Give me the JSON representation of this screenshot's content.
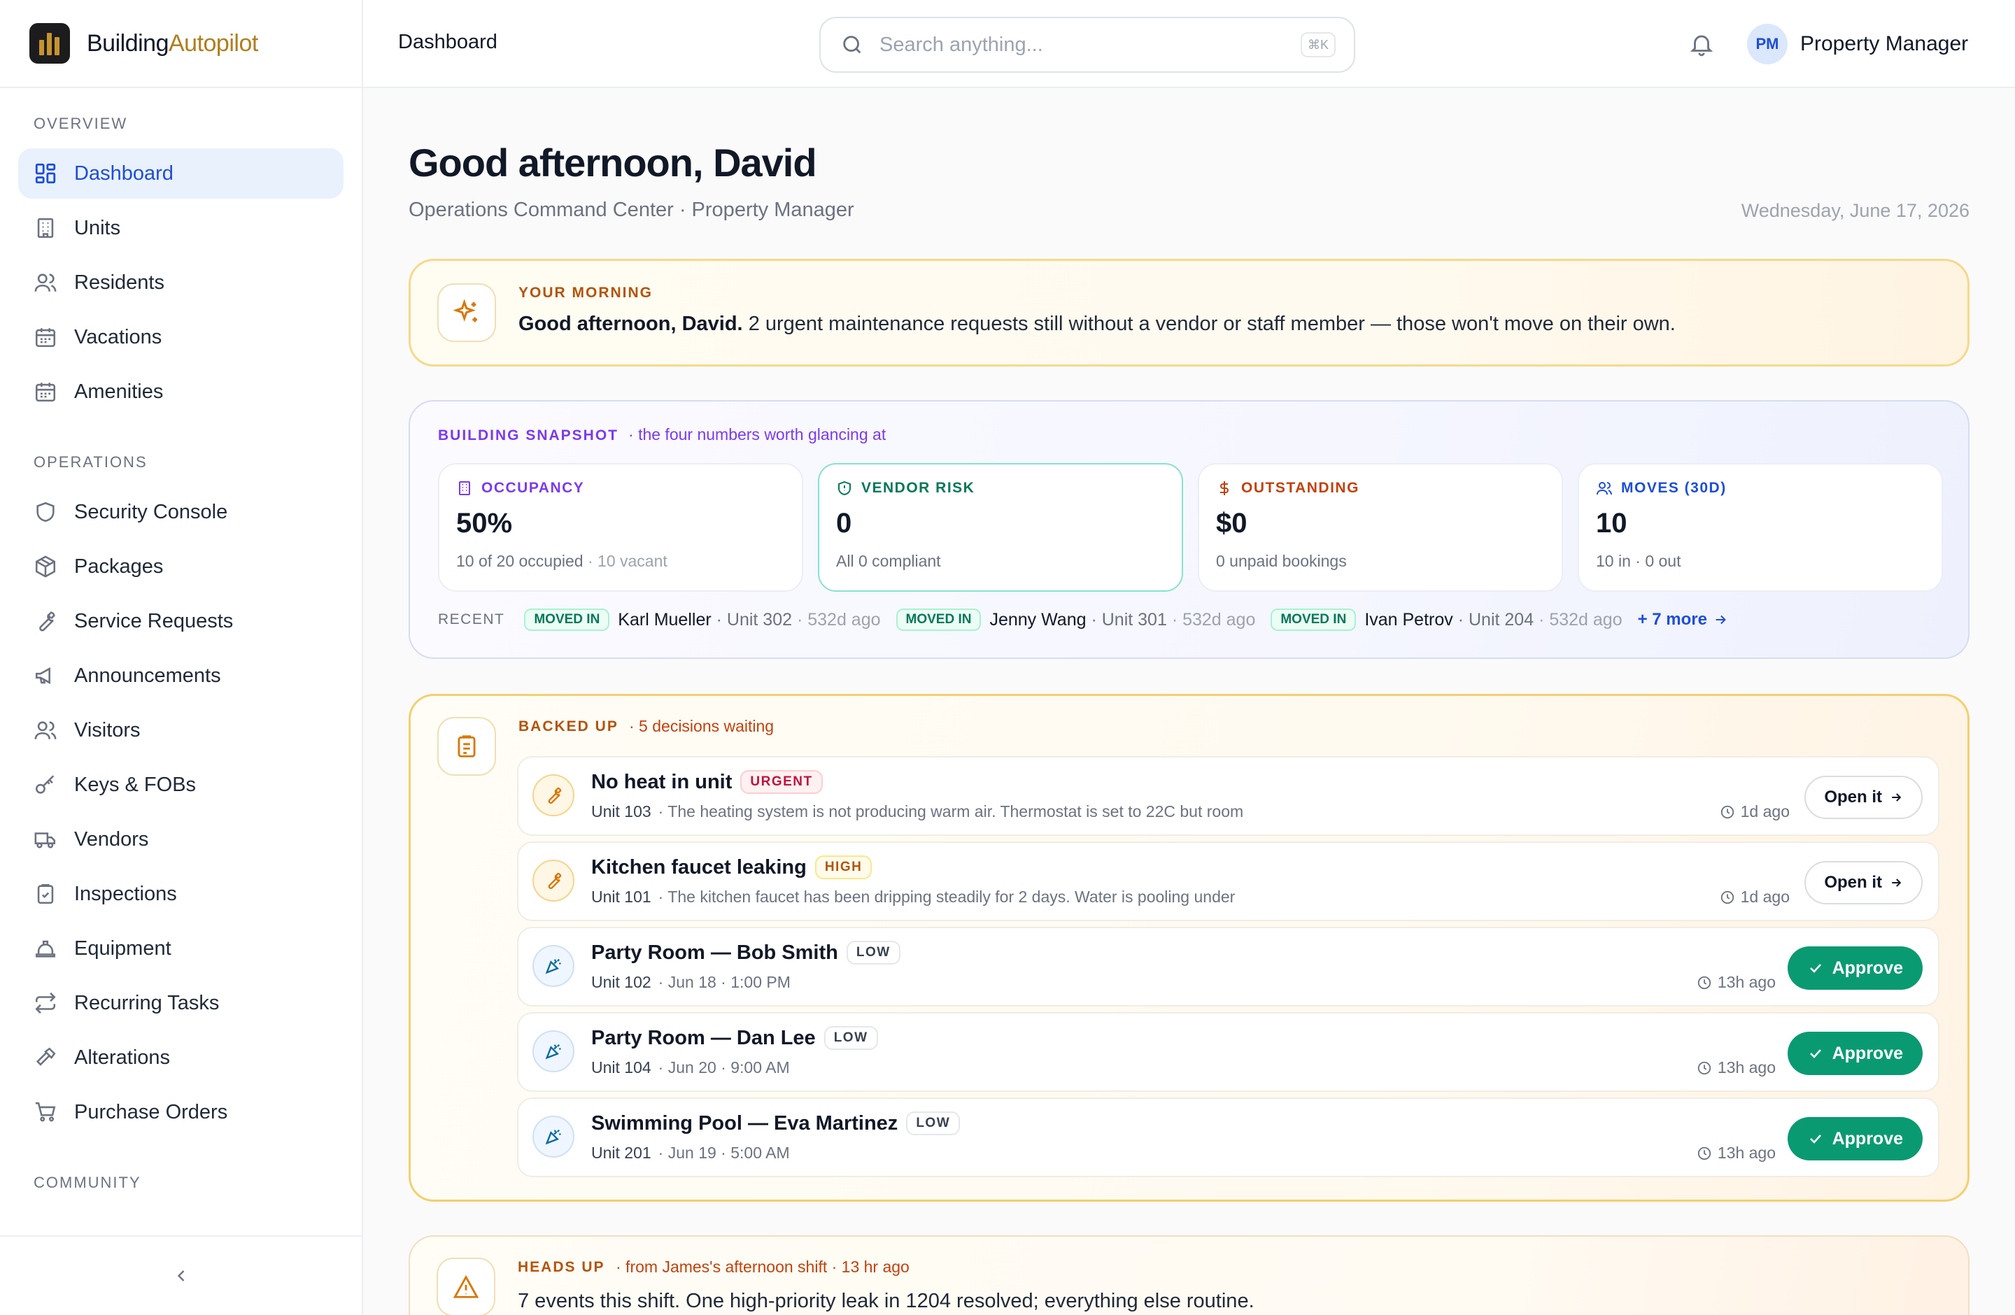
{
  "brand": {
    "name_part1": "Building",
    "name_part2": "Autopilot"
  },
  "sidebar": {
    "sections": [
      {
        "label": "OVERVIEW"
      },
      {
        "label": "OPERATIONS"
      },
      {
        "label": "COMMUNITY"
      }
    ],
    "overview_items": [
      {
        "label": "Dashboard",
        "icon": "grid-icon",
        "active": true
      },
      {
        "label": "Units",
        "icon": "building-icon"
      },
      {
        "label": "Residents",
        "icon": "users-icon"
      },
      {
        "label": "Vacations",
        "icon": "calendar-icon"
      },
      {
        "label": "Amenities",
        "icon": "calendar-icon"
      }
    ],
    "operations_items": [
      {
        "label": "Security Console",
        "icon": "shield-icon"
      },
      {
        "label": "Packages",
        "icon": "package-icon"
      },
      {
        "label": "Service Requests",
        "icon": "wrench-icon"
      },
      {
        "label": "Announcements",
        "icon": "megaphone-icon"
      },
      {
        "label": "Visitors",
        "icon": "users-icon"
      },
      {
        "label": "Keys & FOBs",
        "icon": "key-icon"
      },
      {
        "label": "Vendors",
        "icon": "truck-icon"
      },
      {
        "label": "Inspections",
        "icon": "clipboard-check-icon"
      },
      {
        "label": "Equipment",
        "icon": "hardhat-icon"
      },
      {
        "label": "Recurring Tasks",
        "icon": "repeat-icon"
      },
      {
        "label": "Alterations",
        "icon": "hammer-icon"
      },
      {
        "label": "Purchase Orders",
        "icon": "cart-icon"
      }
    ],
    "collapse_icon": "chevron-left-icon"
  },
  "topbar": {
    "breadcrumb": "Dashboard",
    "search_placeholder": "Search anything...",
    "search_shortcut": "⌘K",
    "user_initials": "PM",
    "user_name": "Property Manager"
  },
  "main": {
    "greeting": "Good afternoon, David",
    "subtitle": "Operations Command Center · Property Manager",
    "date": "Wednesday, June 17, 2026",
    "morning": {
      "eyebrow": "YOUR MORNING",
      "message_bold": "Good afternoon, David.",
      "message": "2 urgent maintenance requests still without a vendor or staff member — those won't move on their own."
    },
    "snapshot": {
      "eyebrow": "BUILDING SNAPSHOT",
      "subtitle": "· the four numbers worth glancing at",
      "metrics": [
        {
          "label": "OCCUPANCY",
          "value": "50%",
          "foot": "10 of 20 occupied",
          "foot_muted": "· 10 vacant",
          "color": "#7c3aed"
        },
        {
          "label": "VENDOR RISK",
          "value": "0",
          "foot": "All 0 compliant",
          "foot_muted": "",
          "color": "#047857"
        },
        {
          "label": "OUTSTANDING",
          "value": "$0",
          "foot": "0 unpaid bookings",
          "foot_muted": "",
          "color": "#c2410c"
        },
        {
          "label": "MOVES (30D)",
          "value": "10",
          "foot": "10 in · 0 out",
          "foot_muted": "",
          "color": "#1d4ed8"
        }
      ],
      "recent_label": "RECENT",
      "recent": [
        {
          "badge": "MOVED IN",
          "name": "Karl Mueller",
          "unit": "· Unit 302",
          "ago": "· 532d ago"
        },
        {
          "badge": "MOVED IN",
          "name": "Jenny Wang",
          "unit": "· Unit 301",
          "ago": "· 532d ago"
        },
        {
          "badge": "MOVED IN",
          "name": "Ivan Petrov",
          "unit": "· Unit 204",
          "ago": "· 532d ago"
        }
      ],
      "more_link": "+ 7 more"
    },
    "backed_up": {
      "eyebrow": "BACKED UP",
      "subtitle": "· 5 decisions waiting",
      "requests": [
        {
          "title": "No heat in unit",
          "priority": "URGENT",
          "unit": "Unit 103",
          "desc": "· The heating system is not producing warm air. Thermostat is set to 22C but room",
          "time": "1d ago",
          "action": "Open it"
        },
        {
          "title": "Kitchen faucet leaking",
          "priority": "HIGH",
          "unit": "Unit 101",
          "desc": "· The kitchen faucet has been dripping steadily for 2 days. Water is pooling under",
          "time": "1d ago",
          "action": "Open it"
        },
        {
          "title": "Party Room — Bob Smith",
          "priority": "LOW",
          "unit": "Unit 102",
          "desc": "· Jun 18 · 1:00 PM",
          "time": "13h ago",
          "action": "Approve"
        },
        {
          "title": "Party Room — Dan Lee",
          "priority": "LOW",
          "unit": "Unit 104",
          "desc": "· Jun 20 · 9:00 AM",
          "time": "13h ago",
          "action": "Approve"
        },
        {
          "title": "Swimming Pool — Eva Martinez",
          "priority": "LOW",
          "unit": "Unit 201",
          "desc": "· Jun 19 · 5:00 AM",
          "time": "13h ago",
          "action": "Approve"
        }
      ]
    },
    "heads_up": {
      "eyebrow": "HEADS UP",
      "subtitle": "· from James's afternoon shift · 13 hr ago",
      "message": "7 events this shift. One high-priority leak in 1204 resolved; everything else routine."
    }
  }
}
